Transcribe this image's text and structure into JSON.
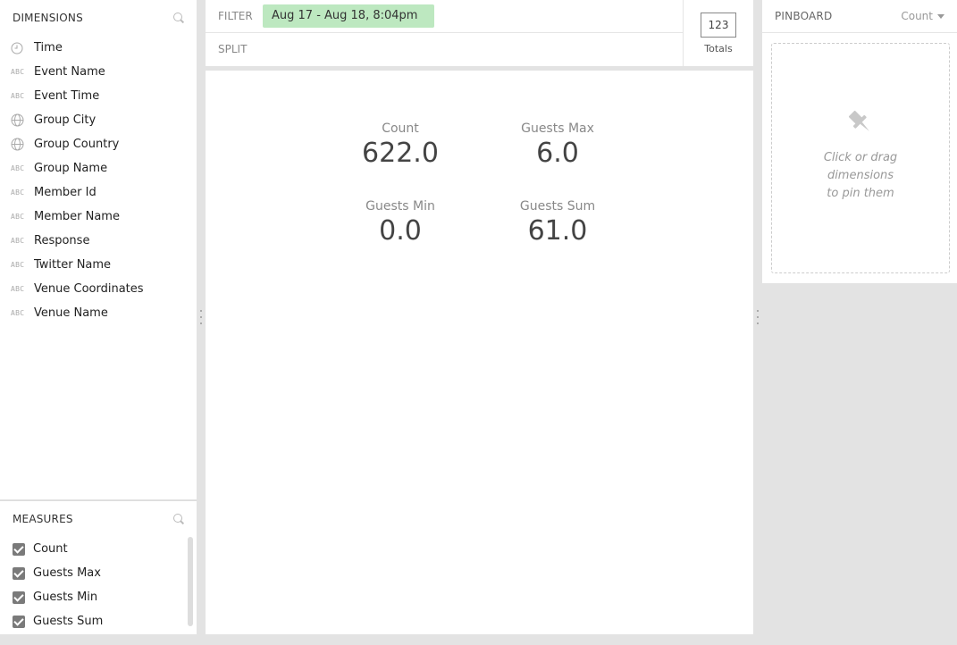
{
  "dimensions": {
    "title": "DIMENSIONS",
    "items": [
      {
        "label": "Time",
        "icon": "clock-icon"
      },
      {
        "label": "Event Name",
        "icon": "abc-icon"
      },
      {
        "label": "Event Time",
        "icon": "abc-icon"
      },
      {
        "label": "Group City",
        "icon": "globe-icon"
      },
      {
        "label": "Group Country",
        "icon": "globe-icon"
      },
      {
        "label": "Group Name",
        "icon": "abc-icon"
      },
      {
        "label": "Member Id",
        "icon": "abc-icon"
      },
      {
        "label": "Member Name",
        "icon": "abc-icon"
      },
      {
        "label": "Response",
        "icon": "abc-icon"
      },
      {
        "label": "Twitter Name",
        "icon": "abc-icon"
      },
      {
        "label": "Venue Coordinates",
        "icon": "abc-icon"
      },
      {
        "label": "Venue Name",
        "icon": "abc-icon"
      }
    ],
    "abc_glyph": "ABC"
  },
  "measures": {
    "title": "MEASURES",
    "items": [
      {
        "label": "Count",
        "checked": true
      },
      {
        "label": "Guests Max",
        "checked": true
      },
      {
        "label": "Guests Min",
        "checked": true
      },
      {
        "label": "Guests Sum",
        "checked": true
      }
    ]
  },
  "filter": {
    "label": "FILTER",
    "pill": "Aug 17 - Aug 18, 8:04pm",
    "pill_color": "#bde8c0"
  },
  "split": {
    "label": "SPLIT"
  },
  "totals": {
    "glyph": "123",
    "label": "Totals"
  },
  "visual": {
    "measures": [
      {
        "label": "Count",
        "value": "622.0"
      },
      {
        "label": "Guests Max",
        "value": "6.0"
      },
      {
        "label": "Guests Min",
        "value": "0.0"
      },
      {
        "label": "Guests Sum",
        "value": "61.0"
      }
    ]
  },
  "pinboard": {
    "title": "PINBOARD",
    "sort": "Count",
    "hint_line1": "Click or drag dimensions",
    "hint_line2": "to pin them"
  }
}
